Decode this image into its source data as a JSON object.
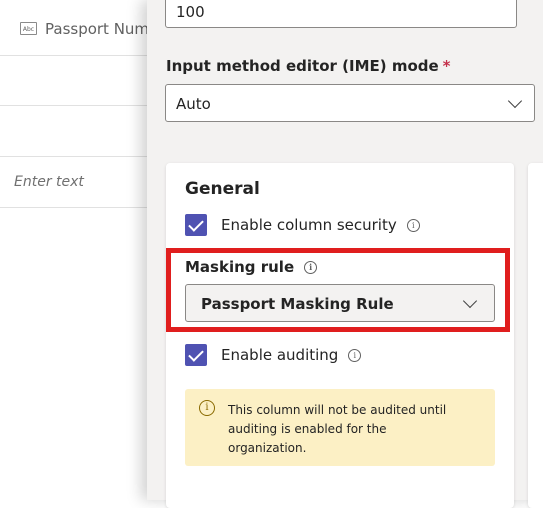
{
  "table": {
    "column_title": "Passport Num",
    "column_icon_text": "Abc",
    "placeholder": "Enter text"
  },
  "panel": {
    "max_length_value": "100",
    "ime": {
      "label": "Input method editor (IME) mode",
      "required_marker": "*",
      "value": "Auto"
    },
    "general": {
      "title": "General",
      "column_security_label": "Enable column security",
      "masking_rule_label": "Masking rule",
      "masking_rule_value": "Passport Masking Rule",
      "auditing_label": "Enable auditing",
      "audit_notice": "This column will not be audited until auditing is enabled for the organization."
    }
  },
  "icons": {
    "info": "i",
    "warning": "i"
  },
  "colors": {
    "checkbox": "#4f52b2",
    "highlight": "#e01e1e",
    "notice_bg": "#fcf0c5",
    "required": "#c4314b"
  }
}
